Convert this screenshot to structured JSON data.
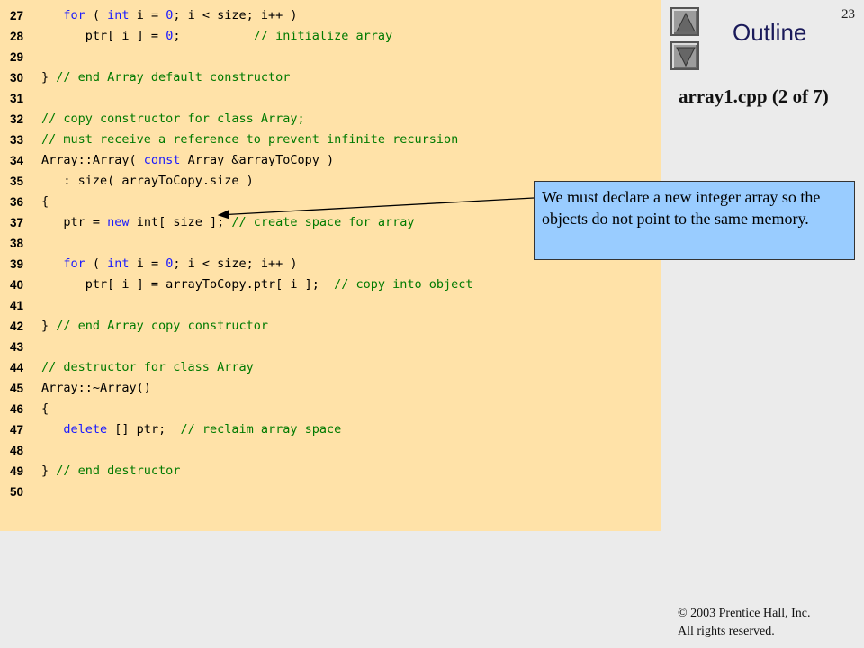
{
  "slide": {
    "number": "23",
    "outline_label": "Outline",
    "file_caption": "array1.cpp (2 of 7)"
  },
  "navigation": {
    "up_icon": "triangle-up-icon",
    "down_icon": "triangle-down-icon"
  },
  "code": {
    "lines": [
      {
        "num": "27",
        "indent": "   ",
        "tokens": [
          {
            "t": "for",
            "c": "kw"
          },
          {
            "t": " ( "
          },
          {
            "t": "int",
            "c": "kw"
          },
          {
            "t": " i = "
          },
          {
            "t": "0",
            "c": "num"
          },
          {
            "t": "; i < size; i++ )"
          }
        ]
      },
      {
        "num": "28",
        "indent": "      ",
        "tokens": [
          {
            "t": "ptr[ i ] = "
          },
          {
            "t": "0",
            "c": "num"
          },
          {
            "t": ";          "
          },
          {
            "t": "// initialize array",
            "c": "cm"
          }
        ]
      },
      {
        "num": "29",
        "indent": "",
        "tokens": []
      },
      {
        "num": "30",
        "indent": "",
        "tokens": [
          {
            "t": "} "
          },
          {
            "t": "// end Array default constructor",
            "c": "cm"
          }
        ]
      },
      {
        "num": "31",
        "indent": "",
        "tokens": []
      },
      {
        "num": "32",
        "indent": "",
        "tokens": [
          {
            "t": "// copy constructor for class Array;",
            "c": "cm"
          }
        ]
      },
      {
        "num": "33",
        "indent": "",
        "tokens": [
          {
            "t": "// must receive a reference to prevent infinite recursion",
            "c": "cm"
          }
        ]
      },
      {
        "num": "34",
        "indent": "",
        "tokens": [
          {
            "t": "Array::Array( "
          },
          {
            "t": "const",
            "c": "kw"
          },
          {
            "t": " Array &arrayToCopy )"
          }
        ]
      },
      {
        "num": "35",
        "indent": "   ",
        "tokens": [
          {
            "t": ": size( arrayToCopy.size )"
          }
        ]
      },
      {
        "num": "36",
        "indent": "",
        "tokens": [
          {
            "t": "{"
          }
        ]
      },
      {
        "num": "37",
        "indent": "   ",
        "tokens": [
          {
            "t": "ptr = "
          },
          {
            "t": "new",
            "c": "kw"
          },
          {
            "t": " int[ size ]; "
          },
          {
            "t": "// create space for array",
            "c": "cm"
          }
        ]
      },
      {
        "num": "38",
        "indent": "",
        "tokens": []
      },
      {
        "num": "39",
        "indent": "   ",
        "tokens": [
          {
            "t": "for",
            "c": "kw"
          },
          {
            "t": " ( "
          },
          {
            "t": "int",
            "c": "kw"
          },
          {
            "t": " i = "
          },
          {
            "t": "0",
            "c": "num"
          },
          {
            "t": "; i < size; i++ )"
          }
        ]
      },
      {
        "num": "40",
        "indent": "      ",
        "tokens": [
          {
            "t": "ptr[ i ] = arrayToCopy.ptr[ i ];  "
          },
          {
            "t": "// copy into object",
            "c": "cm"
          }
        ]
      },
      {
        "num": "41",
        "indent": "",
        "tokens": []
      },
      {
        "num": "42",
        "indent": "",
        "tokens": [
          {
            "t": "} "
          },
          {
            "t": "// end Array copy constructor",
            "c": "cm"
          }
        ]
      },
      {
        "num": "43",
        "indent": "",
        "tokens": []
      },
      {
        "num": "44",
        "indent": "",
        "tokens": [
          {
            "t": "// destructor for class Array",
            "c": "cm"
          }
        ]
      },
      {
        "num": "45",
        "indent": "",
        "tokens": [
          {
            "t": "Array::~Array()"
          }
        ]
      },
      {
        "num": "46",
        "indent": "",
        "tokens": [
          {
            "t": "{"
          }
        ]
      },
      {
        "num": "47",
        "indent": "   ",
        "tokens": [
          {
            "t": "delete",
            "c": "kw"
          },
          {
            "t": " [] ptr;  "
          },
          {
            "t": "// reclaim array space",
            "c": "cm"
          }
        ]
      },
      {
        "num": "48",
        "indent": "",
        "tokens": []
      },
      {
        "num": "49",
        "indent": "",
        "tokens": [
          {
            "t": "} "
          },
          {
            "t": "// end destructor",
            "c": "cm"
          }
        ]
      },
      {
        "num": "50",
        "indent": "",
        "tokens": []
      }
    ]
  },
  "callout": {
    "text": "We must declare a new integer array so the objects do not point to the same memory."
  },
  "footer": {
    "copyright_symbol": "©",
    "copyright_line1": " 2003 Prentice Hall, Inc.",
    "copyright_line2": "All rights reserved."
  },
  "colors": {
    "code_background": "#ffe2a8",
    "keyword": "#1a1aff",
    "comment": "#007a00",
    "callout_background": "#99ccff"
  }
}
